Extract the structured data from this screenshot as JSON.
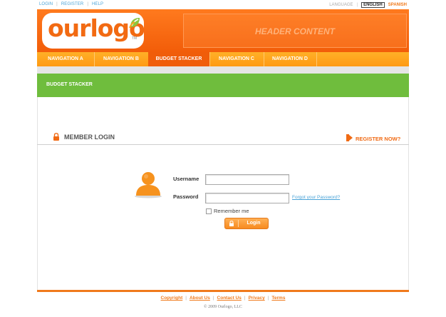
{
  "top": {
    "links": [
      "LOGIN",
      "REGISTER",
      "HELP"
    ],
    "language_label": "LANGUAGE",
    "language_selected": "ENGLISH",
    "language_other": "SPANISH"
  },
  "header": {
    "logo_text": "ourlogo",
    "logo_tm": "TM",
    "content_text": "HEADER CONTENT"
  },
  "nav": {
    "items": [
      "NAVIGATION A",
      "NAVIGATION B",
      "BUDGET STACKER",
      "NAVIGATION C",
      "NAVIGATION D"
    ],
    "active": "BUDGET STACKER"
  },
  "section": {
    "title": "BUDGET STACKER"
  },
  "login": {
    "title": "MEMBER LOGIN",
    "register_link": "REGISTER NOW?",
    "username_label": "Username",
    "username_value": "",
    "password_label": "Password",
    "password_value": "",
    "forgot_link": "Forgot your Password?",
    "remember_label": "Remember me",
    "remember_checked": false,
    "button_label": "Login"
  },
  "footer": {
    "links": [
      "Copyright",
      "About Us",
      "Contact Us",
      "Privacy",
      "Terms"
    ],
    "copyright": "© 2009 Ourlogo, LLC"
  },
  "colors": {
    "brand_orange": "#f26a12",
    "nav_orange": "#ffa51e",
    "section_green": "#6fbd3d",
    "link_blue": "#4aa3d8"
  }
}
